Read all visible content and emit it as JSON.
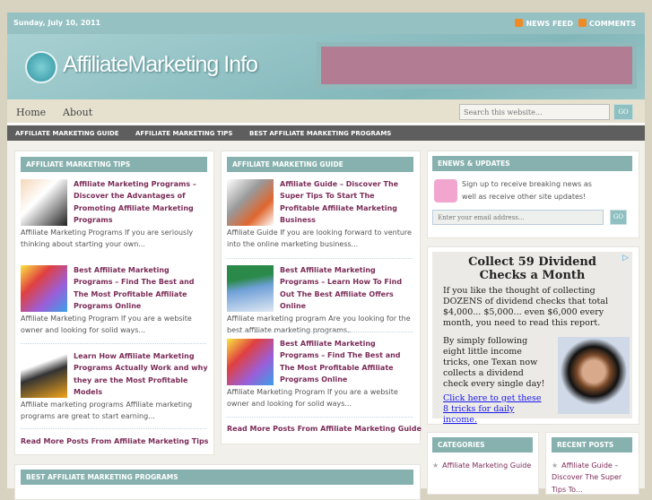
{
  "topbar": {
    "date": "Sunday, July 10, 2011",
    "news_feed": "NEWS FEED",
    "comments": "COMMENTS"
  },
  "header": {
    "logo": "AffiliateMarketing Info"
  },
  "nav": {
    "home": "Home",
    "about": "About",
    "search_placeholder": "Search this website...",
    "go": "GO"
  },
  "menu": [
    "AFFILIATE MARKETING GUIDE",
    "AFFILIATE MARKETING TIPS",
    "BEST AFFILIATE MARKETING PROGRAMS"
  ],
  "tips": {
    "title": "AFFILIATE MARKETING TIPS",
    "posts": [
      {
        "title": "Affiliate Marketing Programs – Discover the Advantages of Promoting Affiliate Marketing Programs",
        "excerpt": "Affiliate Marketing Programs If you are seriously thinking about starting your own..."
      },
      {
        "title": "Best Affiliate Marketing Programs – Find The Best and The Most Profitable Affiliate Programs Online",
        "excerpt": "Affiliate Marketing Program If you are a website owner and looking for solid ways..."
      },
      {
        "title": "Learn How Affiliate Marketing Programs Actually Work and why they are the Most Profitable Models",
        "excerpt": "Affiliate marketing programs Affiliate marketing programs are great to start earning..."
      }
    ],
    "more": "Read More Posts From Affiliate Marketing Tips"
  },
  "guide": {
    "title": "AFFILIATE MARKETING GUIDE",
    "posts": [
      {
        "title": "Affiliate Guide – Discover The Super Tips To Start The Profitable Affiliate Marketing Business",
        "excerpt": "Affiliate Guide If you are looking forward to venture into the online marketing business..."
      },
      {
        "title": "Best Affiliate Marketing Programs – Learn How To Find Out The Best Affiliate Offers Online",
        "excerpt": "Affiliate marketing program Are you looking for the best affiliate marketing programs..."
      },
      {
        "title": "Best Affiliate Marketing Programs – Find The Best and The Most Profitable Affiliate Programs Online",
        "excerpt": "Affiliate Marketing Program If you are a website owner and looking for solid ways..."
      }
    ],
    "more": "Read More Posts From Affiliate Marketing Guide"
  },
  "enews": {
    "title": "ENEWS & UPDATES",
    "text": "Sign up to receive breaking news as well as receive other site updates!",
    "placeholder": "Enter your email address...",
    "go": "GO"
  },
  "ad": {
    "headline": "Collect 59 Dividend Checks a Month",
    "p1": "If you like the thought of collecting DOZENS of dividend checks that total $4,000... $5,000... even $6,000 every month, you need to read this report.",
    "p2": "By simply following eight little income tricks, one Texan now collects a dividend check every single day!",
    "link": "Click here to get these 8 tricks for daily income."
  },
  "categories": {
    "title": "CATEGORIES",
    "items": [
      "Affiliate Marketing Guide"
    ]
  },
  "recent": {
    "title": "RECENT POSTS",
    "items": [
      "Affiliate Guide – Discover The Super Tips To..."
    ]
  },
  "bottom": {
    "title": "BEST AFFILIATE MARKETING PROGRAMS"
  }
}
